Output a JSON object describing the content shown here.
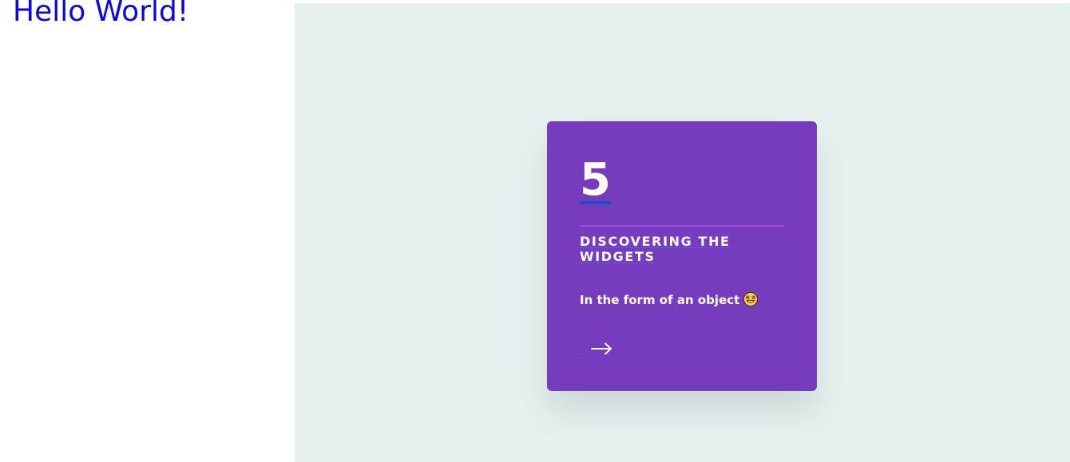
{
  "heading": "Hello World!",
  "card": {
    "number": "5",
    "title": "Discovering the widgets",
    "text": "In the form of an object",
    "emoji_icon": "star-struck-emoji-icon",
    "link_icon": "arrow-right-icon"
  },
  "colors": {
    "heading": "#0b06e6",
    "stage_background": "#e5f0ef",
    "card_background": "#773cbd",
    "card_divider": "#a14ddf",
    "link_underline": "#1f4ccc",
    "text": "#ffffff"
  }
}
